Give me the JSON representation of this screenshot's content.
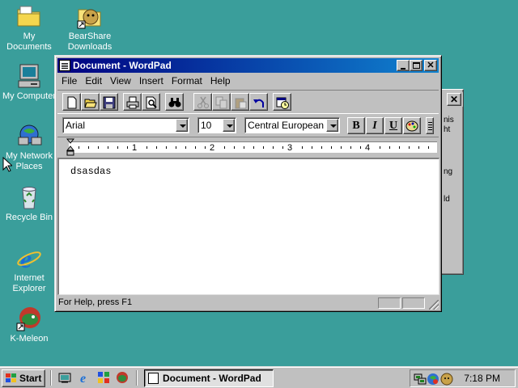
{
  "desktop": {
    "icons": [
      {
        "label": "My Documents"
      },
      {
        "label": "BearShare Downloads"
      },
      {
        "label": "My Computer"
      },
      {
        "label": "My Network Places"
      },
      {
        "label": "Recycle Bin"
      },
      {
        "label": "Internet Explorer"
      },
      {
        "label": "K-Meleon"
      }
    ],
    "background_color": "#3a9e9b"
  },
  "background_dialog": {
    "fragments": [
      "nis",
      "ht",
      "ng",
      "ld"
    ]
  },
  "window": {
    "title": "Document - WordPad",
    "menu": [
      "File",
      "Edit",
      "View",
      "Insert",
      "Format",
      "Help"
    ],
    "toolbar_icons": [
      "new-icon",
      "open-icon",
      "save-icon",
      "print-icon",
      "print-preview-icon",
      "find-icon",
      "cut-icon",
      "copy-icon",
      "paste-icon",
      "undo-icon",
      "date-time-icon"
    ],
    "format": {
      "font": "Arial",
      "size": "10",
      "script": "Central European",
      "bold": "B",
      "italic": "I",
      "underline": "U"
    },
    "ruler_numbers": [
      "1",
      "2",
      "3",
      "4"
    ],
    "document_text": "dsasdas",
    "status": "For Help, press F1"
  },
  "taskbar": {
    "start_label": "Start",
    "task_label": "Document - WordPad",
    "clock": "7:18 PM"
  }
}
